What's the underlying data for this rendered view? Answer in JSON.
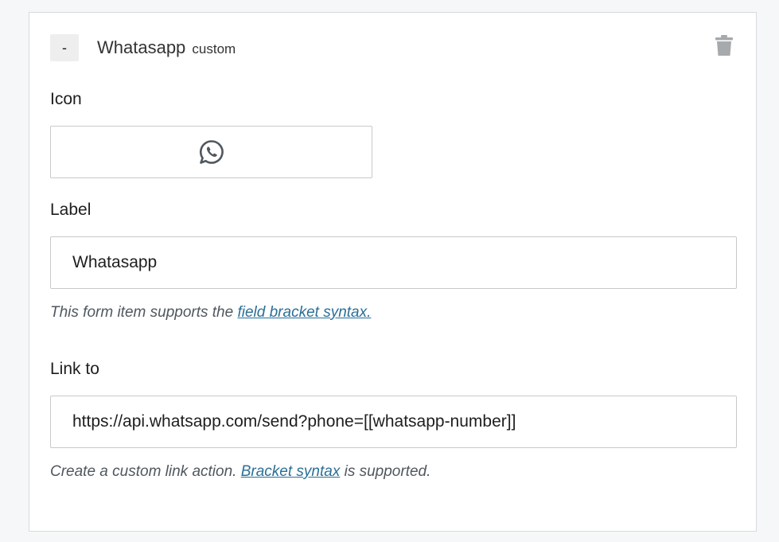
{
  "item": {
    "collapse_label": "-",
    "title": "Whatasapp",
    "subtitle": "custom"
  },
  "icon_field": {
    "label": "Icon",
    "selected_icon": "whatsapp-icon"
  },
  "label_field": {
    "label": "Label",
    "value": "Whatasapp",
    "help_prefix": "This form item supports the ",
    "help_link": "field bracket syntax."
  },
  "link_field": {
    "label": "Link to",
    "value": "https://api.whatsapp.com/send?phone=[[whatsapp-number]]",
    "help_prefix": "Create a custom link action. ",
    "help_link": "Bracket syntax",
    "help_suffix": " is supported."
  },
  "colors": {
    "link": "#2a6f97",
    "border": "#c9c9c9",
    "trash": "#a7aaad"
  }
}
